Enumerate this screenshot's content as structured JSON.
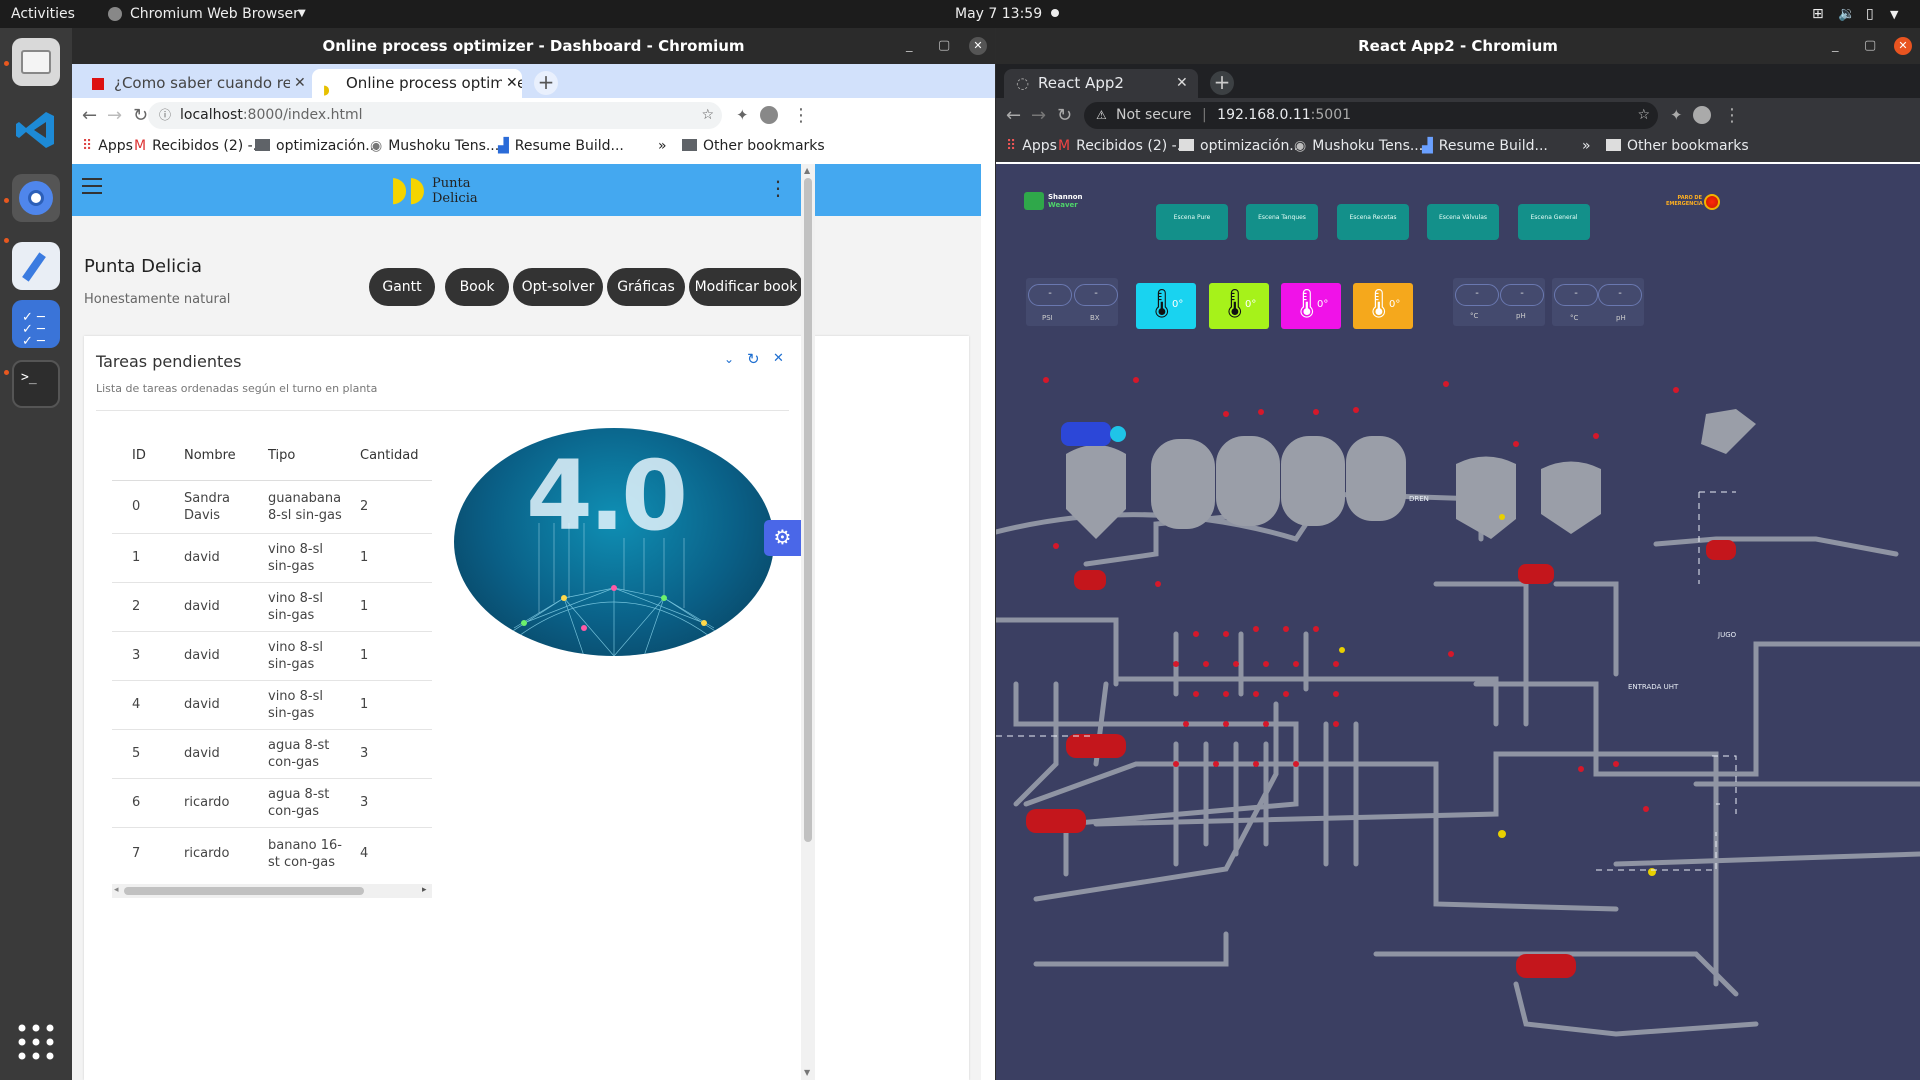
{
  "topbar": {
    "activities": "Activities",
    "app_menu": "Chromium Web Browser",
    "datetime": "May 7  13:59"
  },
  "windowL": {
    "title": "Online process optimizer - Dashboard - Chromium",
    "tabs": [
      {
        "label": "¿Como saber cuando reci",
        "active": false
      },
      {
        "label": "Online process optimizer",
        "active": true
      }
    ],
    "url_host": "localhost",
    "url_path": ":8000/index.html",
    "bookmarks": [
      "Apps",
      "Recibidos (2) -...",
      "optimización...",
      "Mushoku Tens...",
      "Resume Build..."
    ],
    "bookmarks_more": "»",
    "other_bookmarks": "Other bookmarks",
    "page": {
      "brand_line1": "Punta",
      "brand_line2": "Delicia",
      "heading": "Punta Delicia",
      "subtitle": "Honestamente natural",
      "buttons": [
        "Gantt",
        "Book",
        "Opt-solver",
        "Gráficas",
        "Modificar book"
      ],
      "card_title": "Tareas pendientes",
      "card_subtitle": "Lista de tareas ordenadas según el turno en planta",
      "table": {
        "headers": [
          "ID",
          "Nombre",
          "Tipo",
          "Cantidad"
        ],
        "rows": [
          [
            "0",
            "Sandra Davis",
            "guanabana 8-sl sin-gas",
            "2"
          ],
          [
            "1",
            "david",
            "vino 8-sl sin-gas",
            "1"
          ],
          [
            "2",
            "david",
            "vino 8-sl sin-gas",
            "1"
          ],
          [
            "3",
            "david",
            "vino 8-sl sin-gas",
            "1"
          ],
          [
            "4",
            "david",
            "vino 8-sl sin-gas",
            "1"
          ],
          [
            "5",
            "david",
            "agua 8-st con-gas",
            "3"
          ],
          [
            "6",
            "ricardo",
            "agua 8-st con-gas",
            "3"
          ],
          [
            "7",
            "ricardo",
            "banano 16-st con-gas",
            "4"
          ]
        ]
      },
      "image_text": "4.0"
    }
  },
  "windowR": {
    "title": "React App2 - Chromium",
    "tab_label": "React App2",
    "security": "Not secure",
    "url_host": "192.168.0.11",
    "url_path": ":5001",
    "bookmarks": [
      "Apps",
      "Recibidos (2) -...",
      "optimización...",
      "Mushoku Tens...",
      "Resume Build..."
    ],
    "bookmarks_more": "»",
    "other_bookmarks": "Other bookmarks",
    "scada": {
      "logo_line1": "Shannon",
      "logo_line2": "Weaver",
      "scenes": [
        "Escena Pure",
        "Escena Tanques",
        "Escena Recetas",
        "Escena Válvulas",
        "Escena General"
      ],
      "emergency_line1": "PARO DE",
      "emergency_line2": "EMERGENCIA",
      "gauge_group1": {
        "values": [
          "-",
          "-"
        ],
        "labels": [
          "PSI",
          "BX"
        ]
      },
      "thermo": [
        {
          "value": "0°",
          "color": "#19d3f0"
        },
        {
          "value": "0°",
          "color": "#a6f21a"
        },
        {
          "value": "0°",
          "color": "#f012e8"
        },
        {
          "value": "0°",
          "color": "#f5a81c"
        }
      ],
      "gauge_group2": {
        "values": [
          "-",
          "-"
        ],
        "labels": [
          "°C",
          "pH"
        ]
      },
      "gauge_group3": {
        "values": [
          "-",
          "-"
        ],
        "labels": [
          "°C",
          "pH"
        ]
      },
      "labels": {
        "dren": "DREN",
        "jugo": "JUGO",
        "entrada": "ENTRADA UHT"
      }
    }
  }
}
